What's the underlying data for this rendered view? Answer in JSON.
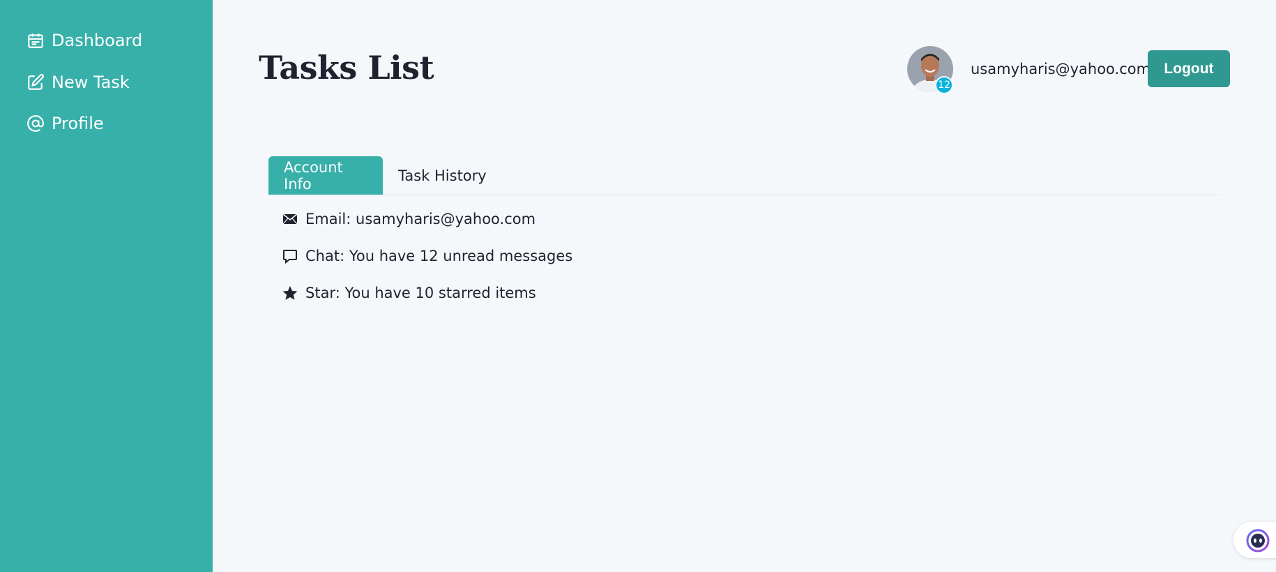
{
  "sidebar": {
    "items": [
      {
        "label": "Dashboard",
        "icon": "calendar-icon"
      },
      {
        "label": "New Task",
        "icon": "edit-icon"
      },
      {
        "label": "Profile",
        "icon": "at-icon"
      }
    ]
  },
  "header": {
    "title": "Tasks List",
    "avatar_badge": "12",
    "email": "usamyharis@yahoo.com",
    "logout_label": "Logout"
  },
  "tabs": [
    {
      "label": "Account Info",
      "active": true
    },
    {
      "label": "Task History",
      "active": false
    }
  ],
  "account_info": [
    {
      "icon": "envelope-icon",
      "text": "Email: usamyharis@yahoo.com"
    },
    {
      "icon": "chat-icon",
      "text": "Chat: You have 12 unread messages"
    },
    {
      "icon": "star-icon",
      "text": "Star: You have 10 starred items"
    }
  ],
  "colors": {
    "sidebar": "#37b0aa",
    "accent_button": "#2f9891",
    "badge": "#0bb3dc",
    "background": "#f5f8fb"
  }
}
